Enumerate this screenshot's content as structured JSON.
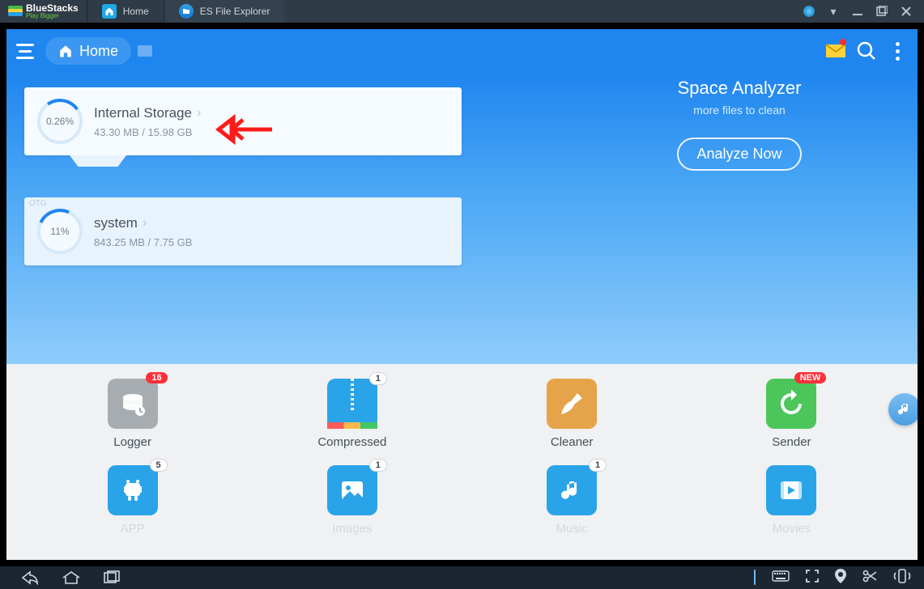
{
  "titlebar": {
    "brand": "BlueStacks",
    "tagline": "Play Bigger",
    "tabs": [
      {
        "label": "Home"
      },
      {
        "label": "ES File Explorer"
      }
    ]
  },
  "es_header": {
    "home_label": "Home"
  },
  "analyzer": {
    "title": "Space Analyzer",
    "subtitle": "more files to clean",
    "button": "Analyze Now"
  },
  "storage": {
    "internal": {
      "percent": "0.26%",
      "title": "Internal Storage",
      "used": "43.30 MB / 15.98 GB"
    },
    "system": {
      "tag": "OTG",
      "percent": "11%",
      "title": "system",
      "used": "843.25 MB / 7.75 GB"
    }
  },
  "tools": {
    "row1": [
      {
        "id": "logger",
        "label": "Logger",
        "badge": "16",
        "badge_style": "red",
        "tile": "grey"
      },
      {
        "id": "compressed",
        "label": "Compressed",
        "badge": "1",
        "badge_style": "white",
        "tile": "blue"
      },
      {
        "id": "cleaner",
        "label": "Cleaner",
        "badge": "",
        "badge_style": "",
        "tile": "orange"
      },
      {
        "id": "sender",
        "label": "Sender",
        "badge": "NEW",
        "badge_style": "red",
        "tile": "green"
      }
    ],
    "row2": [
      {
        "id": "app",
        "label": "APP",
        "badge": "5",
        "badge_style": "white",
        "tile": "blue2"
      },
      {
        "id": "images",
        "label": "Images",
        "badge": "1",
        "badge_style": "white",
        "tile": "blue2"
      },
      {
        "id": "music",
        "label": "Music",
        "badge": "1",
        "badge_style": "white",
        "tile": "blue2"
      },
      {
        "id": "movies",
        "label": "Movies",
        "badge": "",
        "badge_style": "",
        "tile": "blue2"
      }
    ]
  }
}
